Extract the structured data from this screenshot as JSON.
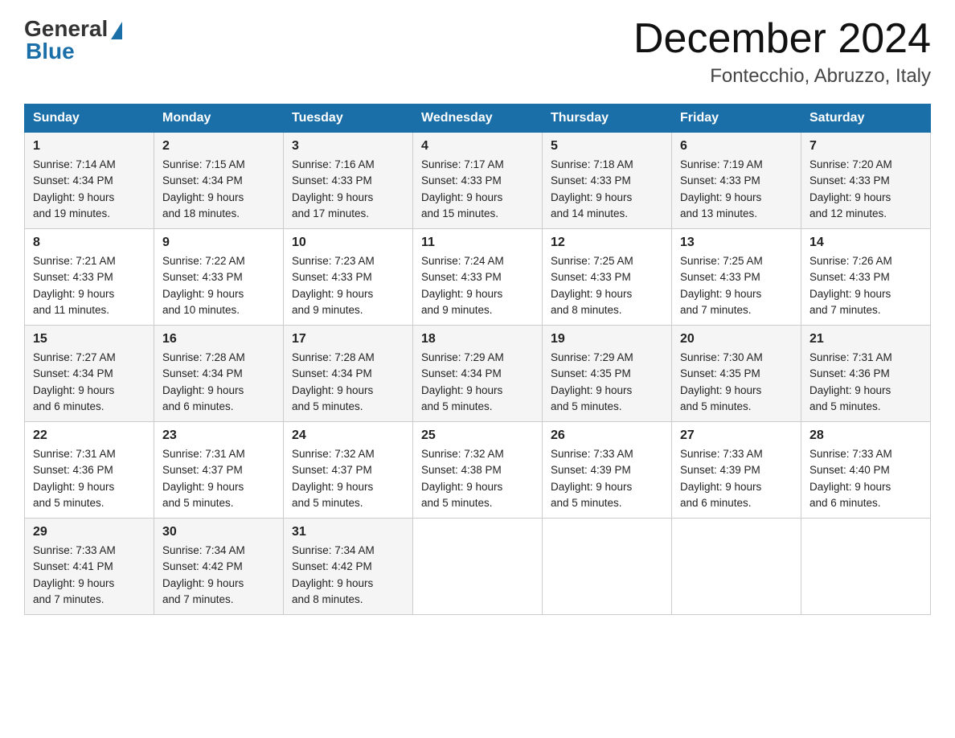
{
  "header": {
    "logo_general": "General",
    "logo_blue": "Blue",
    "month_title": "December 2024",
    "location": "Fontecchio, Abruzzo, Italy"
  },
  "days_of_week": [
    "Sunday",
    "Monday",
    "Tuesday",
    "Wednesday",
    "Thursday",
    "Friday",
    "Saturday"
  ],
  "weeks": [
    [
      {
        "day": "1",
        "sunrise": "7:14 AM",
        "sunset": "4:34 PM",
        "daylight": "9 hours and 19 minutes."
      },
      {
        "day": "2",
        "sunrise": "7:15 AM",
        "sunset": "4:34 PM",
        "daylight": "9 hours and 18 minutes."
      },
      {
        "day": "3",
        "sunrise": "7:16 AM",
        "sunset": "4:33 PM",
        "daylight": "9 hours and 17 minutes."
      },
      {
        "day": "4",
        "sunrise": "7:17 AM",
        "sunset": "4:33 PM",
        "daylight": "9 hours and 15 minutes."
      },
      {
        "day": "5",
        "sunrise": "7:18 AM",
        "sunset": "4:33 PM",
        "daylight": "9 hours and 14 minutes."
      },
      {
        "day": "6",
        "sunrise": "7:19 AM",
        "sunset": "4:33 PM",
        "daylight": "9 hours and 13 minutes."
      },
      {
        "day": "7",
        "sunrise": "7:20 AM",
        "sunset": "4:33 PM",
        "daylight": "9 hours and 12 minutes."
      }
    ],
    [
      {
        "day": "8",
        "sunrise": "7:21 AM",
        "sunset": "4:33 PM",
        "daylight": "9 hours and 11 minutes."
      },
      {
        "day": "9",
        "sunrise": "7:22 AM",
        "sunset": "4:33 PM",
        "daylight": "9 hours and 10 minutes."
      },
      {
        "day": "10",
        "sunrise": "7:23 AM",
        "sunset": "4:33 PM",
        "daylight": "9 hours and 9 minutes."
      },
      {
        "day": "11",
        "sunrise": "7:24 AM",
        "sunset": "4:33 PM",
        "daylight": "9 hours and 9 minutes."
      },
      {
        "day": "12",
        "sunrise": "7:25 AM",
        "sunset": "4:33 PM",
        "daylight": "9 hours and 8 minutes."
      },
      {
        "day": "13",
        "sunrise": "7:25 AM",
        "sunset": "4:33 PM",
        "daylight": "9 hours and 7 minutes."
      },
      {
        "day": "14",
        "sunrise": "7:26 AM",
        "sunset": "4:33 PM",
        "daylight": "9 hours and 7 minutes."
      }
    ],
    [
      {
        "day": "15",
        "sunrise": "7:27 AM",
        "sunset": "4:34 PM",
        "daylight": "9 hours and 6 minutes."
      },
      {
        "day": "16",
        "sunrise": "7:28 AM",
        "sunset": "4:34 PM",
        "daylight": "9 hours and 6 minutes."
      },
      {
        "day": "17",
        "sunrise": "7:28 AM",
        "sunset": "4:34 PM",
        "daylight": "9 hours and 5 minutes."
      },
      {
        "day": "18",
        "sunrise": "7:29 AM",
        "sunset": "4:34 PM",
        "daylight": "9 hours and 5 minutes."
      },
      {
        "day": "19",
        "sunrise": "7:29 AM",
        "sunset": "4:35 PM",
        "daylight": "9 hours and 5 minutes."
      },
      {
        "day": "20",
        "sunrise": "7:30 AM",
        "sunset": "4:35 PM",
        "daylight": "9 hours and 5 minutes."
      },
      {
        "day": "21",
        "sunrise": "7:31 AM",
        "sunset": "4:36 PM",
        "daylight": "9 hours and 5 minutes."
      }
    ],
    [
      {
        "day": "22",
        "sunrise": "7:31 AM",
        "sunset": "4:36 PM",
        "daylight": "9 hours and 5 minutes."
      },
      {
        "day": "23",
        "sunrise": "7:31 AM",
        "sunset": "4:37 PM",
        "daylight": "9 hours and 5 minutes."
      },
      {
        "day": "24",
        "sunrise": "7:32 AM",
        "sunset": "4:37 PM",
        "daylight": "9 hours and 5 minutes."
      },
      {
        "day": "25",
        "sunrise": "7:32 AM",
        "sunset": "4:38 PM",
        "daylight": "9 hours and 5 minutes."
      },
      {
        "day": "26",
        "sunrise": "7:33 AM",
        "sunset": "4:39 PM",
        "daylight": "9 hours and 5 minutes."
      },
      {
        "day": "27",
        "sunrise": "7:33 AM",
        "sunset": "4:39 PM",
        "daylight": "9 hours and 6 minutes."
      },
      {
        "day": "28",
        "sunrise": "7:33 AM",
        "sunset": "4:40 PM",
        "daylight": "9 hours and 6 minutes."
      }
    ],
    [
      {
        "day": "29",
        "sunrise": "7:33 AM",
        "sunset": "4:41 PM",
        "daylight": "9 hours and 7 minutes."
      },
      {
        "day": "30",
        "sunrise": "7:34 AM",
        "sunset": "4:42 PM",
        "daylight": "9 hours and 7 minutes."
      },
      {
        "day": "31",
        "sunrise": "7:34 AM",
        "sunset": "4:42 PM",
        "daylight": "9 hours and 8 minutes."
      },
      null,
      null,
      null,
      null
    ]
  ],
  "labels": {
    "sunrise": "Sunrise:",
    "sunset": "Sunset:",
    "daylight": "Daylight:"
  }
}
